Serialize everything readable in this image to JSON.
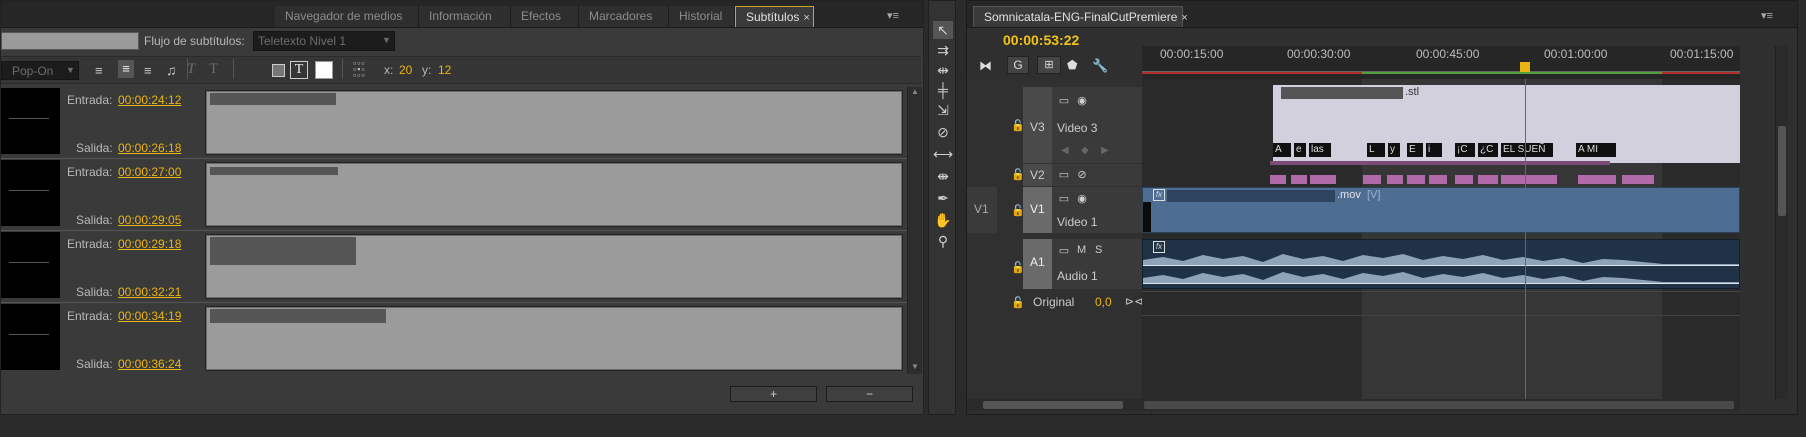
{
  "colors": {
    "accent": "#e8b415",
    "playhead": "#d63b2a",
    "subtitle_clip": "#d3d0dd",
    "video_clip": "#4d6d92",
    "audio_clip": "#203246",
    "v2_clip": "#b06aa8"
  },
  "left_tabs": {
    "items": [
      "Navegador de medios",
      "Información",
      "Efectos",
      "Marcadores",
      "Historial",
      "Subtítulos"
    ],
    "active": "Subtítulos",
    "close_glyph": "×",
    "menu_glyph": "▾≡"
  },
  "subtitle_toolbar": {
    "stream_label": "Flujo de subtítulos:",
    "stream_value": "Teletexto Nivel 1",
    "mode_value": "Pop-On",
    "x_label": "x:",
    "x_value": "20",
    "y_label": "y:",
    "y_value": "12"
  },
  "subtitles": [
    {
      "in_label": "Entrada:",
      "in": "00:00:24:12",
      "out_label": "Salida:",
      "out": "00:00:26:18"
    },
    {
      "in_label": "Entrada:",
      "in": "00:00:27:00",
      "out_label": "Salida:",
      "out": "00:00:29:05"
    },
    {
      "in_label": "Entrada:",
      "in": "00:00:29:18",
      "out_label": "Salida:",
      "out": "00:00:32:21"
    },
    {
      "in_label": "Entrada:",
      "in": "00:00:34:19",
      "out_label": "Salida:",
      "out": "00:00:36:24"
    }
  ],
  "subtitle_buttons": {
    "add": "+",
    "remove": "−"
  },
  "timeline": {
    "tab_title": "Somnicatala-ENG-FinalCutPremiere",
    "close_glyph": "×",
    "menu_glyph": "▾≡",
    "timecode": "00:00:53:22",
    "ruler": [
      "00:00:15:00",
      "00:00:30:00",
      "00:00:45:00",
      "00:01:00:00",
      "00:01:15:00"
    ],
    "tracks": {
      "v3": {
        "id": "V3",
        "name": "Video 3"
      },
      "v2": {
        "id": "V2"
      },
      "v1": {
        "source": "V1",
        "id": "V1",
        "name": "Video 1"
      },
      "a1": {
        "id": "A1",
        "name": "Audio 1",
        "mute": "M",
        "solo": "S"
      },
      "original": {
        "name": "Original",
        "value": "0,0"
      }
    },
    "clips": {
      "stl_suffix": ".stl",
      "mov_suffix": ".mov",
      "mov_tag": "[V]",
      "fx": "fx",
      "subtitle_labels": [
        "A",
        "e",
        "las",
        "L",
        "y",
        "E",
        "i",
        "¡C",
        "¿C",
        "EL SUEÑ",
        "A MI"
      ]
    }
  }
}
